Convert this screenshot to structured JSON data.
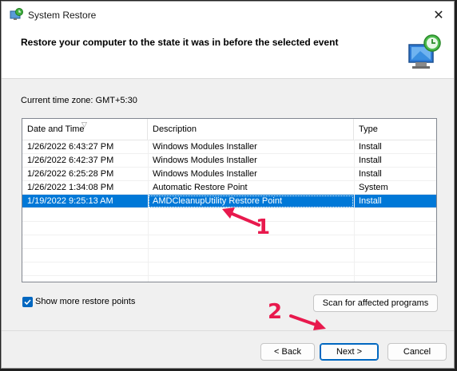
{
  "window": {
    "title": "System Restore",
    "close_symbol": "✕",
    "app_icon": "system-restore-icon",
    "header_icon": "restore-monitor-icon"
  },
  "header": {
    "title": "Restore your computer to the state it was in before the selected event"
  },
  "timezone": {
    "label": "Current time zone: GMT+5:30"
  },
  "table": {
    "columns": [
      "Date and Time",
      "Description",
      "Type"
    ],
    "rows": [
      {
        "date": "1/26/2022 6:43:27 PM",
        "description": "Windows Modules Installer",
        "type": "Install",
        "selected": false
      },
      {
        "date": "1/26/2022 6:42:37 PM",
        "description": "Windows Modules Installer",
        "type": "Install",
        "selected": false
      },
      {
        "date": "1/26/2022 6:25:28 PM",
        "description": "Windows Modules Installer",
        "type": "Install",
        "selected": false
      },
      {
        "date": "1/26/2022 1:34:08 PM",
        "description": "Automatic Restore Point",
        "type": "System",
        "selected": false
      },
      {
        "date": "1/19/2022 9:25:13 AM",
        "description": "AMDCleanupUtility Restore Point",
        "type": "Install",
        "selected": true
      }
    ]
  },
  "options": {
    "show_more_label": "Show more restore points",
    "show_more_checked": true
  },
  "buttons": {
    "scan": "Scan for affected programs",
    "back": "< Back",
    "next": "Next >",
    "cancel": "Cancel"
  },
  "annotations": {
    "marker_1": "1",
    "marker_2": "2",
    "color": "#e8194d"
  },
  "colors": {
    "selection": "#0078d7",
    "accent": "#0067c0"
  }
}
